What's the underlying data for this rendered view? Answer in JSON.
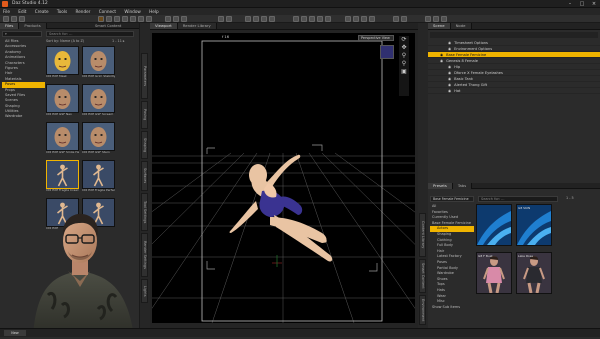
{
  "window": {
    "title": "Daz Studio 4.12"
  },
  "menu": [
    "File",
    "Edit",
    "Create",
    "Tools",
    "Render",
    "Connect",
    "Window",
    "Help"
  ],
  "left_panel": {
    "tabs": [
      "Files",
      "Products"
    ],
    "header": "Smart Content",
    "search_placeholder": "Search for: ...",
    "sort_label": "Sort by: Name (A to Z)",
    "count_label": "1 - 11 ▸",
    "categories": [
      "All Files",
      "Accessories",
      "Anatomy",
      "Animations",
      "Characters",
      "Figures",
      "Hair",
      "Materials",
      "Poses",
      "Props",
      "Saved Files",
      "Scenes",
      "Shaping",
      "Utilities",
      "Wardrobe"
    ],
    "selected_category": "Poses",
    "thumbnails": [
      {
        "label": "CDI EXE Mask"
      },
      {
        "label": "CDI EXE Grim Stability Fatal"
      },
      {
        "label": "CDI EXE GSF Neo"
      },
      {
        "label": "CDI EXE GSF Scream"
      },
      {
        "label": "CDI EXE GSF Smile Head Growl"
      },
      {
        "label": "CDI EXE GSF Stern"
      },
      {
        "label": "CDI EXE Fragile Crawl Hero"
      },
      {
        "label": "CDI EXE Fragile Perfect"
      },
      {
        "label": "CDI EXE"
      },
      {
        "label": "CDI EXE"
      }
    ],
    "footer": "New"
  },
  "side_tabs": {
    "left": [
      "Parameters",
      "Posing",
      "Shaping",
      "Surfaces",
      "Tool Settings",
      "Render Settings",
      "Lights"
    ],
    "right": [
      "Content Library",
      "Smart Content",
      "Environment"
    ]
  },
  "viewport": {
    "tabs": [
      "Viewport",
      "Render Library"
    ],
    "frame_label": "f 16",
    "view_select": "Perspective View"
  },
  "scene": {
    "tabs": [
      "Scene",
      "Node"
    ],
    "items": [
      {
        "label": "Timesheet Options",
        "indent": 2
      },
      {
        "label": "Environment Options",
        "indent": 2
      },
      {
        "label": "Base Female Femicine",
        "indent": 1,
        "selected": true
      },
      {
        "label": "Genesis 8 Female",
        "indent": 1
      },
      {
        "label": "Hip",
        "indent": 2
      },
      {
        "label": "Dforce X Female Eyelashes",
        "indent": 2
      },
      {
        "label": "Basic Tank",
        "indent": 2
      },
      {
        "label": "Alerted Thong Gift",
        "indent": 2
      },
      {
        "label": "Hat",
        "indent": 2
      }
    ]
  },
  "content_browser": {
    "tabs": [
      "Presets",
      "Tabs"
    ],
    "dropdown": "Base Female Femicine",
    "search_placeholder": "Search for: ...",
    "count_label": "1 - 5",
    "tree": [
      {
        "label": "All",
        "indent": 0
      },
      {
        "label": "Favorites",
        "indent": 0
      },
      {
        "label": "Currently Used",
        "indent": 0
      },
      {
        "label": "Base Female Femicine",
        "indent": 0
      },
      {
        "label": "Actors",
        "indent": 1,
        "selected": true
      },
      {
        "label": "Shaping",
        "indent": 1
      },
      {
        "label": "Clothing",
        "indent": 1
      },
      {
        "label": "Full Body",
        "indent": 1
      },
      {
        "label": "Hair",
        "indent": 1
      },
      {
        "label": "Latest Factory",
        "indent": 1
      },
      {
        "label": "Poses",
        "indent": 1
      },
      {
        "label": "Partial Body",
        "indent": 1
      },
      {
        "label": "Wardrobe",
        "indent": 1
      },
      {
        "label": "Shoes",
        "indent": 1
      },
      {
        "label": "Tops",
        "indent": 1
      },
      {
        "label": "Hats",
        "indent": 1
      },
      {
        "label": "Wear",
        "indent": 1
      },
      {
        "label": "Misc",
        "indent": 1
      },
      {
        "label": "Show Sub Items",
        "indent": 0
      }
    ],
    "thumbs": [
      {
        "label": "",
        "kind": "blue"
      },
      {
        "label": "G8 SKIN",
        "kind": "blue"
      },
      {
        "label": "G8 F Bust",
        "kind": "figure"
      },
      {
        "label": "Lake Rose",
        "kind": "figure"
      }
    ]
  },
  "colors": {
    "accent": "#f0b400",
    "panel": "#2b2b2b",
    "viewport_bg": "#000000",
    "skin": "#e9c4a3",
    "outfit": "#3a3391"
  }
}
